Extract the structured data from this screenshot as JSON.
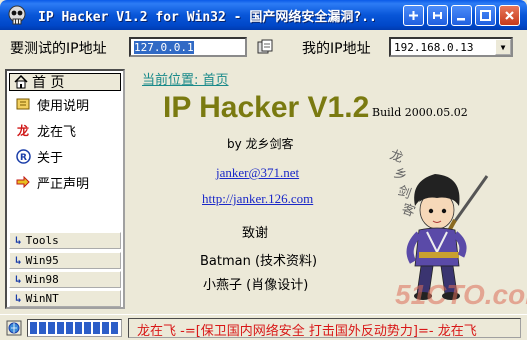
{
  "window": {
    "title": "IP Hacker V1.2 for Win32 - 国产网络安全漏洞?.."
  },
  "address_bar": {
    "target_label": "要测试的IP地址",
    "target_value": "127.0.0.1",
    "my_ip_label": "我的IP地址",
    "my_ip_value": "192.168.0.13"
  },
  "sidebar": {
    "home_label": "首  页",
    "items": [
      {
        "label": "使用说明",
        "icon": "book-icon"
      },
      {
        "label": "龙在飞",
        "icon": "dragon-char-icon"
      },
      {
        "label": "关于",
        "icon": "registered-icon"
      },
      {
        "label": "严正声明",
        "icon": "arrow-right-icon"
      }
    ],
    "categories": [
      {
        "label": "Tools"
      },
      {
        "label": "Win95"
      },
      {
        "label": "Win98"
      },
      {
        "label": "WinNT"
      }
    ]
  },
  "main": {
    "breadcrumb": "当前位置: 首页",
    "app_title": "IP Hacker V1.2",
    "build": "Build 2000.05.02",
    "author": "by 龙乡剑客",
    "email": "janker@371.net",
    "website": "http://janker.126.com",
    "thanks_heading": "致谢",
    "credits": [
      "Batman (技术资料)",
      "小燕子 (肖像设计)"
    ],
    "mascot_label": "龙乡剑客"
  },
  "watermark": "51CTO.com",
  "status": {
    "progress_blocks": 10,
    "marquee": "龙在飞 -=[保卫国内网络安全  打击国外反动势力]=- 龙在飞"
  },
  "colors": {
    "title_bar": "#0856d8",
    "app_title": "#7a7a10",
    "marquee_text": "#d81818",
    "link": "#1a28c8"
  }
}
